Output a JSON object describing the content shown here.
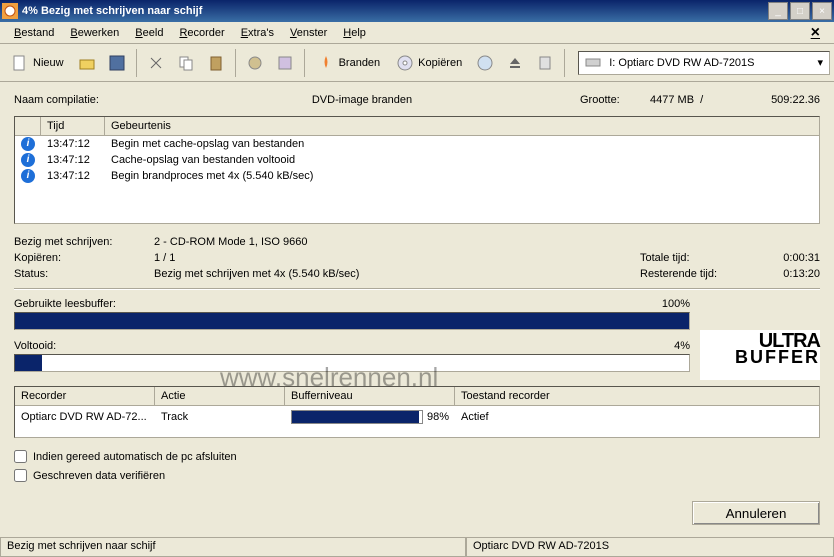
{
  "titlebar": {
    "percent": "4%",
    "text": "Bezig met schrijven naar schijf"
  },
  "menu": {
    "items": [
      "Bestand",
      "Bewerken",
      "Beeld",
      "Recorder",
      "Extra's",
      "Venster",
      "Help"
    ]
  },
  "toolbar": {
    "nieuw": "Nieuw",
    "branden": "Branden",
    "kopieren": "Kopiëren",
    "drive": "I: Optiarc DVD RW AD-7201S"
  },
  "info": {
    "compilatie_lbl": "Naam compilatie:",
    "mode": "DVD-image branden",
    "grootte_lbl": "Grootte:",
    "size_mb": "4477 MB",
    "sep": "/",
    "duration": "509:22.36"
  },
  "log": {
    "headers": {
      "tijd": "Tijd",
      "gebeurtenis": "Gebeurtenis"
    },
    "rows": [
      {
        "time": "13:47:12",
        "event": "Begin met cache-opslag van bestanden"
      },
      {
        "time": "13:47:12",
        "event": "Cache-opslag van bestanden voltooid"
      },
      {
        "time": "13:47:12",
        "event": "Begin brandproces met 4x (5.540 kB/sec)"
      }
    ]
  },
  "status": {
    "writing_lbl": "Bezig met schrijven:",
    "writing_val": "2 - CD-ROM Mode 1, ISO 9660",
    "copy_lbl": "Kopiëren:",
    "copy_val": "1 / 1",
    "total_lbl": "Totale tijd:",
    "total_val": "0:00:31",
    "status_lbl": "Status:",
    "status_val": "Bezig met schrijven met 4x (5.540 kB/sec)",
    "remain_lbl": "Resterende tijd:",
    "remain_val": "0:13:20"
  },
  "progress": {
    "readbuf_lbl": "Gebruikte leesbuffer:",
    "readbuf_pct": "100%",
    "readbuf_fill": 100,
    "done_lbl": "Voltooid:",
    "done_pct": "4%",
    "done_fill": 4
  },
  "ultra": {
    "l1": "ULTRA",
    "l2": "BUFFER"
  },
  "watermark": "www.snelrennen.nl",
  "recorder": {
    "headers": {
      "r1": "Recorder",
      "r2": "Actie",
      "r3": "Bufferniveau",
      "r4": "Toestand recorder"
    },
    "row": {
      "name": "Optiarc DVD RW AD-72...",
      "actie": "Track",
      "buf_pct": "98%",
      "buf_fill": 98,
      "state": "Actief"
    }
  },
  "checks": {
    "shutdown": "Indien gereed automatisch de pc afsluiten",
    "verify": "Geschreven data verifiëren"
  },
  "buttons": {
    "cancel": "Annuleren"
  },
  "statusbar": {
    "left": "Bezig met schrijven naar schijf",
    "right": "Optiarc  DVD RW AD-7201S"
  }
}
